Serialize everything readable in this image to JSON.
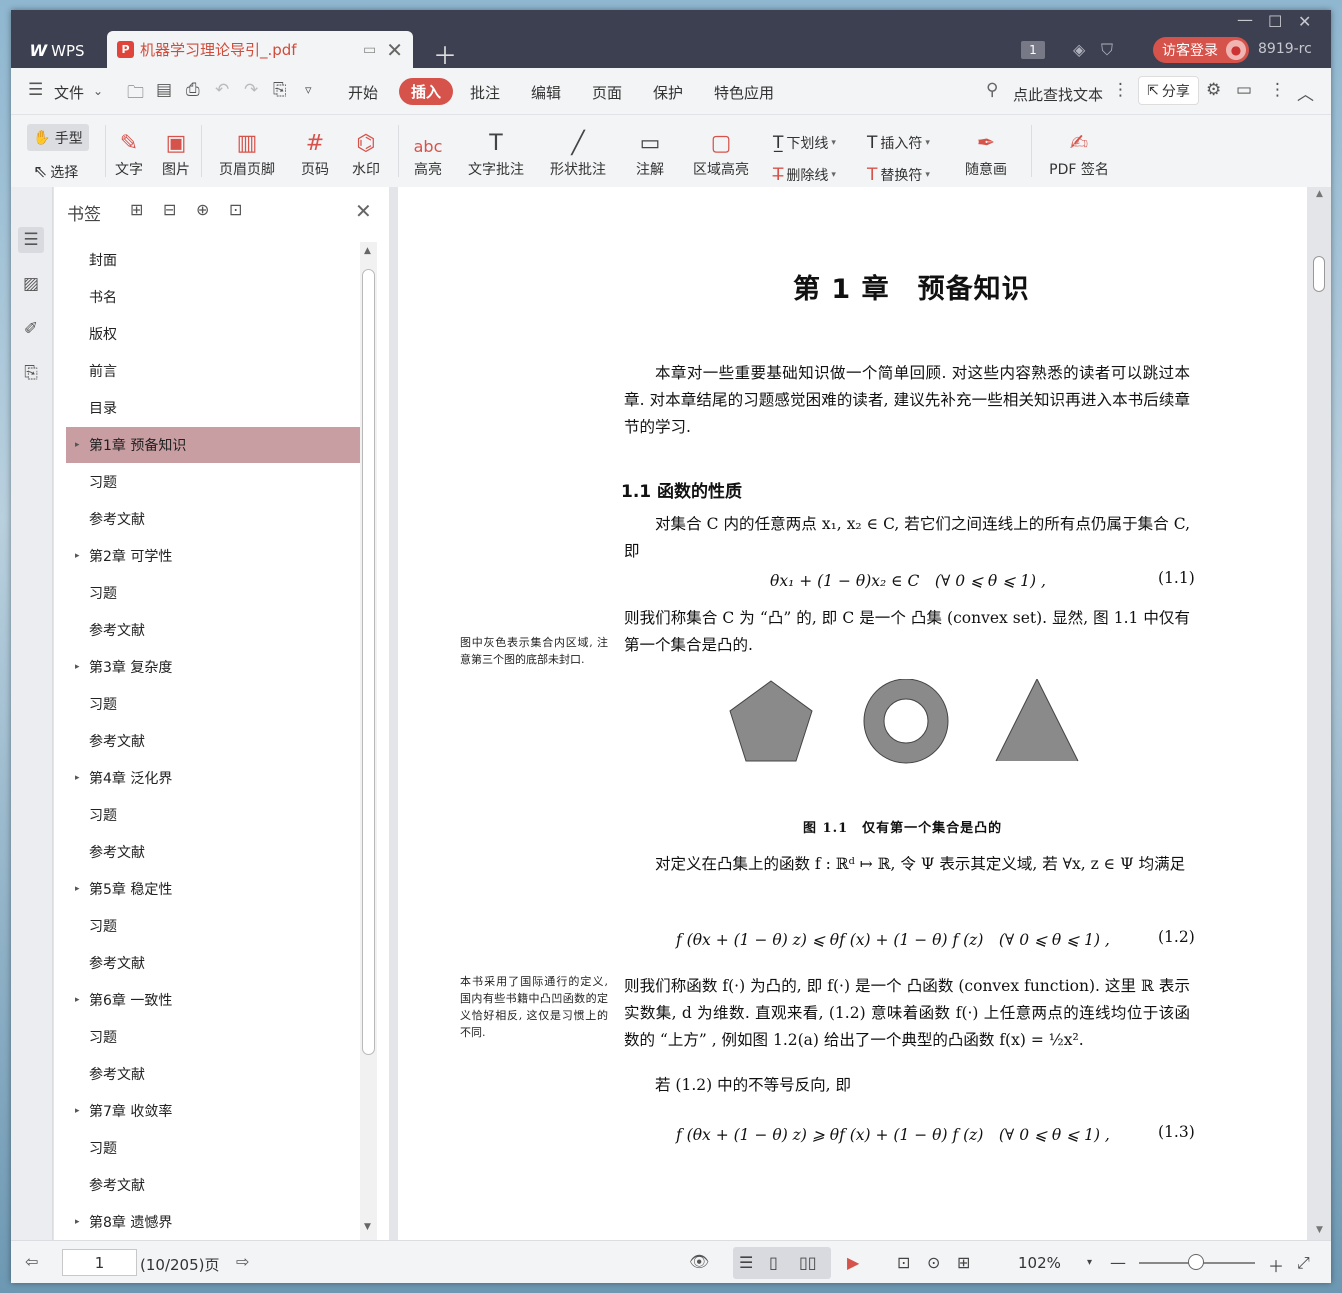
{
  "titlebar": {
    "app_name": "WPS",
    "doc_tab_title": "机器学习理论导引_.pdf",
    "page_badge": "1",
    "login_label": "访客登录",
    "user_id": "8919-rc"
  },
  "menu": {
    "file_label": "文件",
    "items": [
      "开始",
      "插入",
      "批注",
      "编辑",
      "页面",
      "保护",
      "特色应用"
    ],
    "active_item": "插入",
    "search_label": "点此查找文本",
    "share_label": "分享"
  },
  "toolbar": {
    "hand": "手型",
    "select": "选择",
    "text": "文字",
    "image": "图片",
    "header_footer": "页眉页脚",
    "page_number": "页码",
    "watermark": "水印",
    "highlight": "高亮",
    "text_annot": "文字批注",
    "shape_annot": "形状批注",
    "note": "注解",
    "area_highlight": "区域高亮",
    "underline": "下划线",
    "strikethrough": "删除线",
    "insert_mark": "插入符",
    "replace_mark": "替换符",
    "freehand": "随意画",
    "pdf_sign": "PDF 签名"
  },
  "bookmarks": {
    "title": "书签",
    "items": [
      {
        "label": "封面",
        "expandable": false
      },
      {
        "label": "书名",
        "expandable": false
      },
      {
        "label": "版权",
        "expandable": false
      },
      {
        "label": "前言",
        "expandable": false
      },
      {
        "label": "目录",
        "expandable": false
      },
      {
        "label": "第1章 预备知识",
        "expandable": true,
        "selected": true
      },
      {
        "label": "习题",
        "expandable": false
      },
      {
        "label": "参考文献",
        "expandable": false
      },
      {
        "label": "第2章 可学性",
        "expandable": true
      },
      {
        "label": "习题",
        "expandable": false
      },
      {
        "label": "参考文献",
        "expandable": false
      },
      {
        "label": "第3章 复杂度",
        "expandable": true
      },
      {
        "label": "习题",
        "expandable": false
      },
      {
        "label": "参考文献",
        "expandable": false
      },
      {
        "label": "第4章 泛化界",
        "expandable": true
      },
      {
        "label": "习题",
        "expandable": false
      },
      {
        "label": "参考文献",
        "expandable": false
      },
      {
        "label": "第5章 稳定性",
        "expandable": true
      },
      {
        "label": "习题",
        "expandable": false
      },
      {
        "label": "参考文献",
        "expandable": false
      },
      {
        "label": "第6章 一致性",
        "expandable": true
      },
      {
        "label": "习题",
        "expandable": false
      },
      {
        "label": "参考文献",
        "expandable": false
      },
      {
        "label": "第7章 收敛率",
        "expandable": true
      },
      {
        "label": "习题",
        "expandable": false
      },
      {
        "label": "参考文献",
        "expandable": false
      },
      {
        "label": "第8章 遗憾界",
        "expandable": true
      }
    ]
  },
  "document": {
    "chapter_title": "第 1 章　预备知识",
    "intro": "本章对一些重要基础知识做一个简单回顾. 对这些内容熟悉的读者可以跳过本章. 对本章结尾的习题感觉困难的读者, 建议先补充一些相关知识再进入本书后续章节的学习.",
    "section_title": "1.1  函数的性质",
    "p1": "对集合 C 内的任意两点 x₁, x₂ ∈ C, 若它们之间连线上的所有点仍属于集合 C, 即",
    "eq1": "θx₁ + (1 − θ)x₂ ∈ C　(∀ 0 ⩽ θ ⩽ 1) ,",
    "eq1_num": "(1.1)",
    "p2": "则我们称集合 C 为 “凸” 的, 即 C 是一个 凸集 (convex set). 显然, 图 1.1 中仅有第一个集合是凸的.",
    "margin1": "图中灰色表示集合内区域, 注意第三个图的底部未封口.",
    "fig_caption": "图 1.1　仅有第一个集合是凸的",
    "p3": "对定义在凸集上的函数 f : ℝᵈ ↦ ℝ, 令 Ψ 表示其定义域, 若 ∀x, z ∈ Ψ 均满足",
    "eq2": "f (θx + (1 − θ) z) ⩽ θf (x) + (1 − θ) f (z)　(∀ 0 ⩽ θ ⩽ 1) ,",
    "eq2_num": "(1.2)",
    "margin2": "本书采用了国际通行的定义, 国内有些书籍中凸凹函数的定义恰好相反, 这仅是习惯上的不同.",
    "p4": "则我们称函数 f(·) 为凸的, 即 f(·) 是一个 凸函数 (convex function). 这里 ℝ 表示实数集, d 为维数. 直观来看, (1.2) 意味着函数 f(·) 上任意两点的连线均位于该函数的 “上方” , 例如图 1.2(a) 给出了一个典型的凸函数 f(x) = ½x².",
    "p5": "若 (1.2) 中的不等号反向, 即",
    "eq3": "f (θx + (1 − θ) z) ⩾ θf (x) + (1 − θ) f (z)　(∀ 0 ⩽ θ ⩽ 1) ,",
    "eq3_num": "(1.3)"
  },
  "statusbar": {
    "page_input": "1",
    "page_total": "(10/205)页",
    "zoom": "102%"
  },
  "colors": {
    "accent": "#d6534c",
    "titlebar_bg": "#3d4050",
    "bookmark_selected": "#c89ea3"
  }
}
